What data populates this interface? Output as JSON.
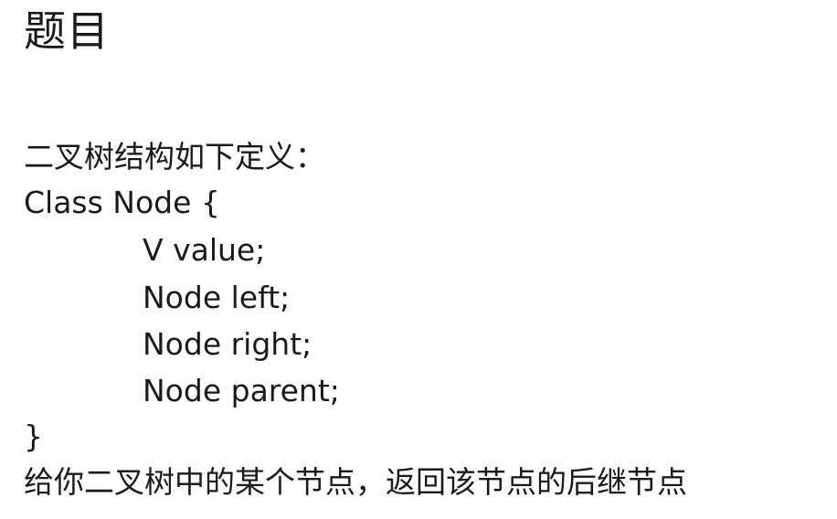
{
  "title": "题目",
  "intro": "二叉树结构如下定义：",
  "code": {
    "class_line": "Class Node {",
    "fields": [
      "V value;",
      "Node left;",
      "Node right;",
      "Node parent;"
    ],
    "close_brace": "}"
  },
  "question": "给你二叉树中的某个节点，返回该节点的后继节点"
}
